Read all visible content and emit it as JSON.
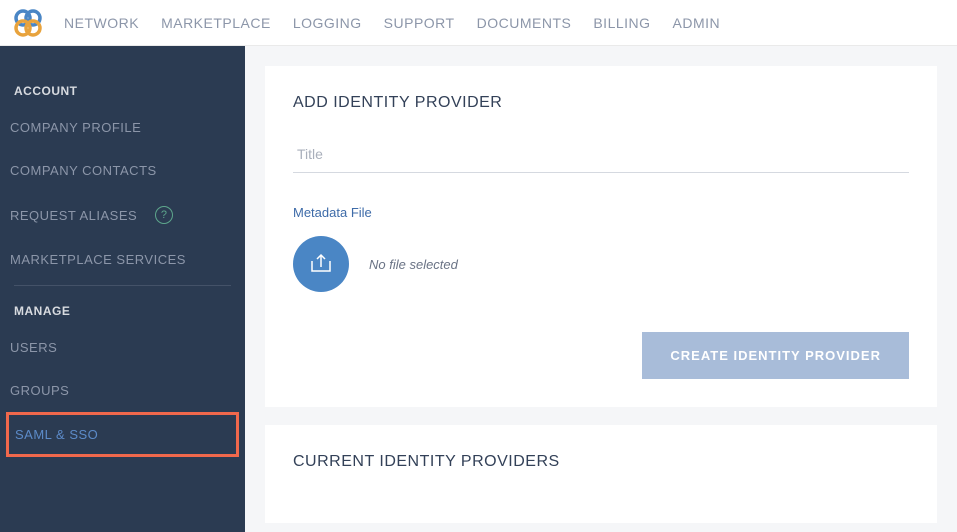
{
  "topnav": {
    "items": [
      "NETWORK",
      "MARKETPLACE",
      "LOGGING",
      "SUPPORT",
      "DOCUMENTS",
      "BILLING",
      "ADMIN"
    ]
  },
  "sidebar": {
    "section1_heading": "ACCOUNT",
    "items1": [
      "COMPANY PROFILE",
      "COMPANY CONTACTS",
      "REQUEST ALIASES",
      "MARKETPLACE SERVICES"
    ],
    "section2_heading": "MANAGE",
    "items2": [
      "USERS",
      "GROUPS",
      "SAML & SSO"
    ]
  },
  "main": {
    "add_title": "ADD IDENTITY PROVIDER",
    "title_placeholder": "Title",
    "metadata_label": "Metadata File",
    "no_file_text": "No file selected",
    "create_button": "CREATE IDENTITY PROVIDER",
    "current_title": "CURRENT IDENTITY PROVIDERS"
  },
  "help_glyph": "?"
}
